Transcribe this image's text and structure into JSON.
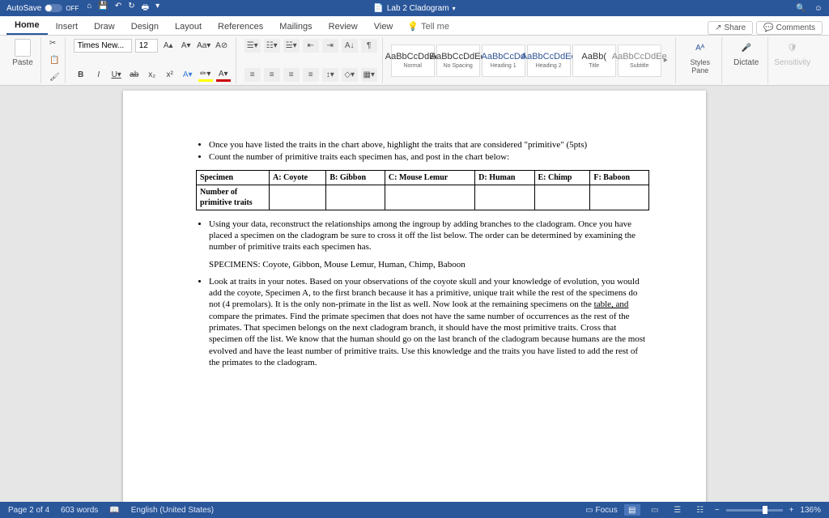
{
  "titlebar": {
    "autosave": "AutoSave",
    "autosave_state": "OFF",
    "doc_icon": "word-doc",
    "doc_title": "Lab 2 Cladogram"
  },
  "tabs": [
    "Home",
    "Insert",
    "Draw",
    "Design",
    "Layout",
    "References",
    "Mailings",
    "Review",
    "View"
  ],
  "tell_me": "Tell me",
  "share": "Share",
  "comments": "Comments",
  "ribbon": {
    "paste": "Paste",
    "font_name": "Times New...",
    "font_size": "12",
    "styles": [
      {
        "sample": "AaBbCcDdEe",
        "label": "Normal"
      },
      {
        "sample": "AaBbCcDdEe",
        "label": "No Spacing"
      },
      {
        "sample": "AaBbCcDd",
        "label": "Heading 1",
        "color": "#2F5496"
      },
      {
        "sample": "AaBbCcDdEe",
        "label": "Heading 2",
        "color": "#2F5496"
      },
      {
        "sample": "AaBb(",
        "label": "Title"
      },
      {
        "sample": "AaBbCcDdEe",
        "label": "Subtitle",
        "color": "#888"
      }
    ],
    "styles_pane": "Styles\nPane",
    "dictate": "Dictate",
    "sensitivity": "Sensitivity"
  },
  "doc": {
    "bullet1": "Once you have listed the traits in the chart above, highlight the traits that are considered \"primitive\" (5pts)",
    "bullet2": "Count the number of primitive traits each specimen has, and post in the chart below:",
    "table": {
      "row1": [
        "Specimen",
        "A: Coyote",
        "B: Gibbon",
        "C: Mouse Lemur",
        "D: Human",
        "E: Chimp",
        "F: Baboon"
      ],
      "row2_label": "Number of primitive traits"
    },
    "bullet3": "Using your data, reconstruct the relationships among the ingroup by adding branches to the cladogram. Once you have placed a specimen on the cladogram be sure to cross it off the list below. The order can be determined by examining the number of primitive traits each specimen has.",
    "specimens": "SPECIMENS: Coyote, Gibbon, Mouse Lemur, Human, Chimp, Baboon",
    "bullet4_a": "Look at traits in your notes. Based on your observations of the coyote skull and your knowledge of evolution, you would add the coyote, Specimen A, to the first branch because it has a primitive, unique trait while the rest of the specimens do not (4 premolars). It is the only non-primate in the list as well. Now look at the remaining specimens on the ",
    "bullet4_link": "table, and",
    "bullet4_b": " compare the primates. Find the primate specimen that does not have the same number of occurrences as the rest of the primates. That specimen belongs on the next cladogram branch, it should have the most primitive traits. Cross that specimen off the list. We know that the human should go on the last branch of the cladogram because humans are the most evolved and have the least number of primitive traits. Use this knowledge and the traits you have listed to add the rest of the primates to the cladogram."
  },
  "status": {
    "page": "Page 2 of 4",
    "words": "603 words",
    "lang": "English (United States)",
    "focus": "Focus",
    "zoom": "136%"
  }
}
